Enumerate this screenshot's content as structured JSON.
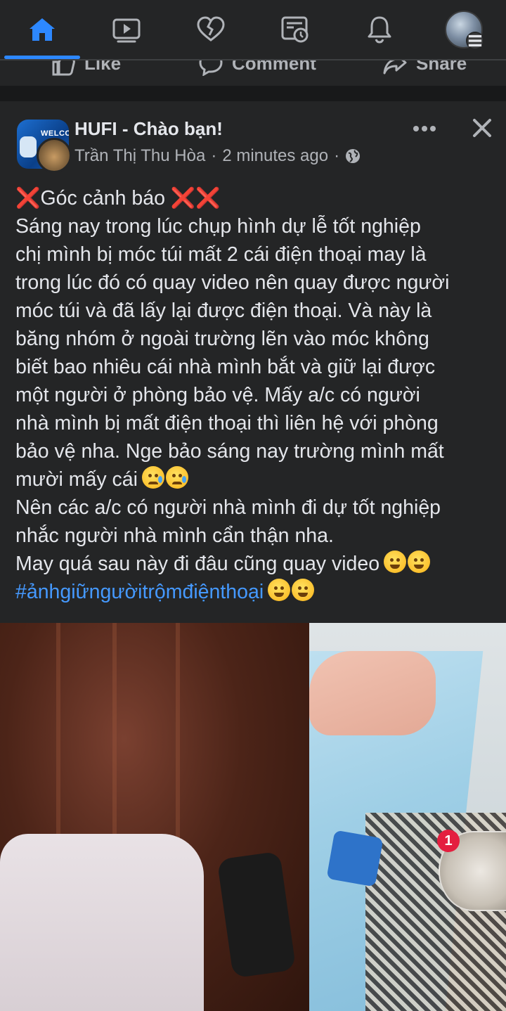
{
  "topnav": {
    "tabs": [
      {
        "name": "home",
        "icon": "home-icon",
        "active": true
      },
      {
        "name": "watch",
        "icon": "video-icon",
        "active": false
      },
      {
        "name": "dating",
        "icon": "heart-icon",
        "active": false
      },
      {
        "name": "memories",
        "icon": "memories-icon",
        "active": false
      },
      {
        "name": "notifications",
        "icon": "bell-icon",
        "active": false
      },
      {
        "name": "menu",
        "icon": "profile-avatar",
        "active": false
      }
    ],
    "accent_color": "#2d88ff"
  },
  "previous_post_actions": {
    "like_label": "Like",
    "comment_label": "Comment",
    "share_label": "Share"
  },
  "post": {
    "group_name": "HUFI - Chào bạn!",
    "group_avatar_text": "WELCC",
    "author": "Trần Thị Thu Hòa",
    "time": "2 minutes ago",
    "separator": "·",
    "privacy_icon": "globe-icon",
    "text": {
      "warning_title": "Góc cảnh báo",
      "lines": [
        "Sáng nay trong lúc chụp hình dự lễ tốt nghiệp",
        "chị mình bị móc túi mất 2 cái điện thoại may là",
        "trong lúc đó có quay video nên quay được người",
        "móc túi và đã lấy lại được điện thoại. Và này là",
        "băng nhóm ở ngoài trường lẽn vào móc không",
        "biết bao nhiêu cái nhà mình bắt và giữ lại được",
        "một người ở phòng bảo vệ. Mấy a/c có người",
        "nhà mình bị mất điện thoại thì liên hệ với phòng",
        "bảo vệ nha. Nge bảo sáng nay trường mình mất",
        "mười mấy cái"
      ],
      "lines2": [
        "Nên các a/c có người nhà mình đi dự tốt nghiệp",
        "nhắc người nhà mình cẩn thận nha."
      ],
      "last_line": "May quá sau này đi đâu cũng quay video",
      "hashtag": "#ảnhgiữngườitrộmđiệnthoại"
    }
  },
  "chat_head": {
    "badge_count": "1"
  }
}
